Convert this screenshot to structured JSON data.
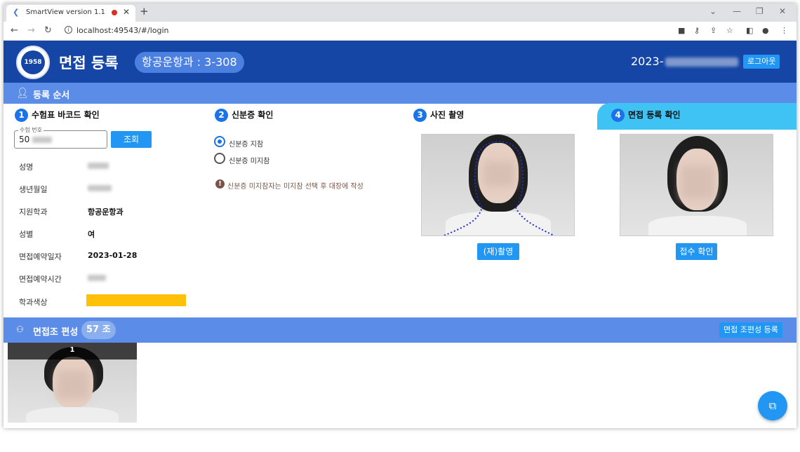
{
  "browser": {
    "tab_title": "SmartView version 1.1",
    "url": "localhost:49543/#/login"
  },
  "header": {
    "title": "면접 등록",
    "dept_badge": "항공운항과 : 3-308",
    "datetime_visible": "2023-",
    "logout_label": "로그아웃",
    "logo_text": "1958"
  },
  "steps_section": {
    "title": "등록 순서",
    "step1": {
      "number": "1",
      "title": "수험표 바코드 확인",
      "field_legend": "수험 번호",
      "field_value": "50",
      "search_button": "조회",
      "rows": [
        {
          "label": "성명",
          "value": ""
        },
        {
          "label": "생년월일",
          "value": ""
        },
        {
          "label": "지원학과",
          "value": "항공운항과"
        },
        {
          "label": "성별",
          "value": "여"
        },
        {
          "label": "면접예약일자",
          "value": "2023-01-28"
        },
        {
          "label": "면접예약시간",
          "value": ""
        },
        {
          "label": "학과색상",
          "value": ""
        }
      ],
      "dept_color": "#ffc107"
    },
    "step2": {
      "number": "2",
      "title": "신분증 확인",
      "option_yes": "신분증 지참",
      "option_no": "신분증 미지참",
      "note": "신분증 미지참자는 미지참 선택 후 대장에 작성"
    },
    "step3": {
      "number": "3",
      "title": "사진 촬영",
      "retake_button": "(재)촬영"
    },
    "step4": {
      "number": "4",
      "title": "면접 등록 확인",
      "confirm_button": "접수 확인"
    }
  },
  "group_section": {
    "title": "면접조 편성",
    "count_badge": "57 조",
    "register_button": "면접 조편성 등록",
    "cards": [
      {
        "number": "1"
      }
    ]
  },
  "colors": {
    "header_bg": "#1646a5",
    "section_bar": "#5b8de8",
    "accent": "#2196f3",
    "step4_highlight": "#3fc3f5"
  }
}
